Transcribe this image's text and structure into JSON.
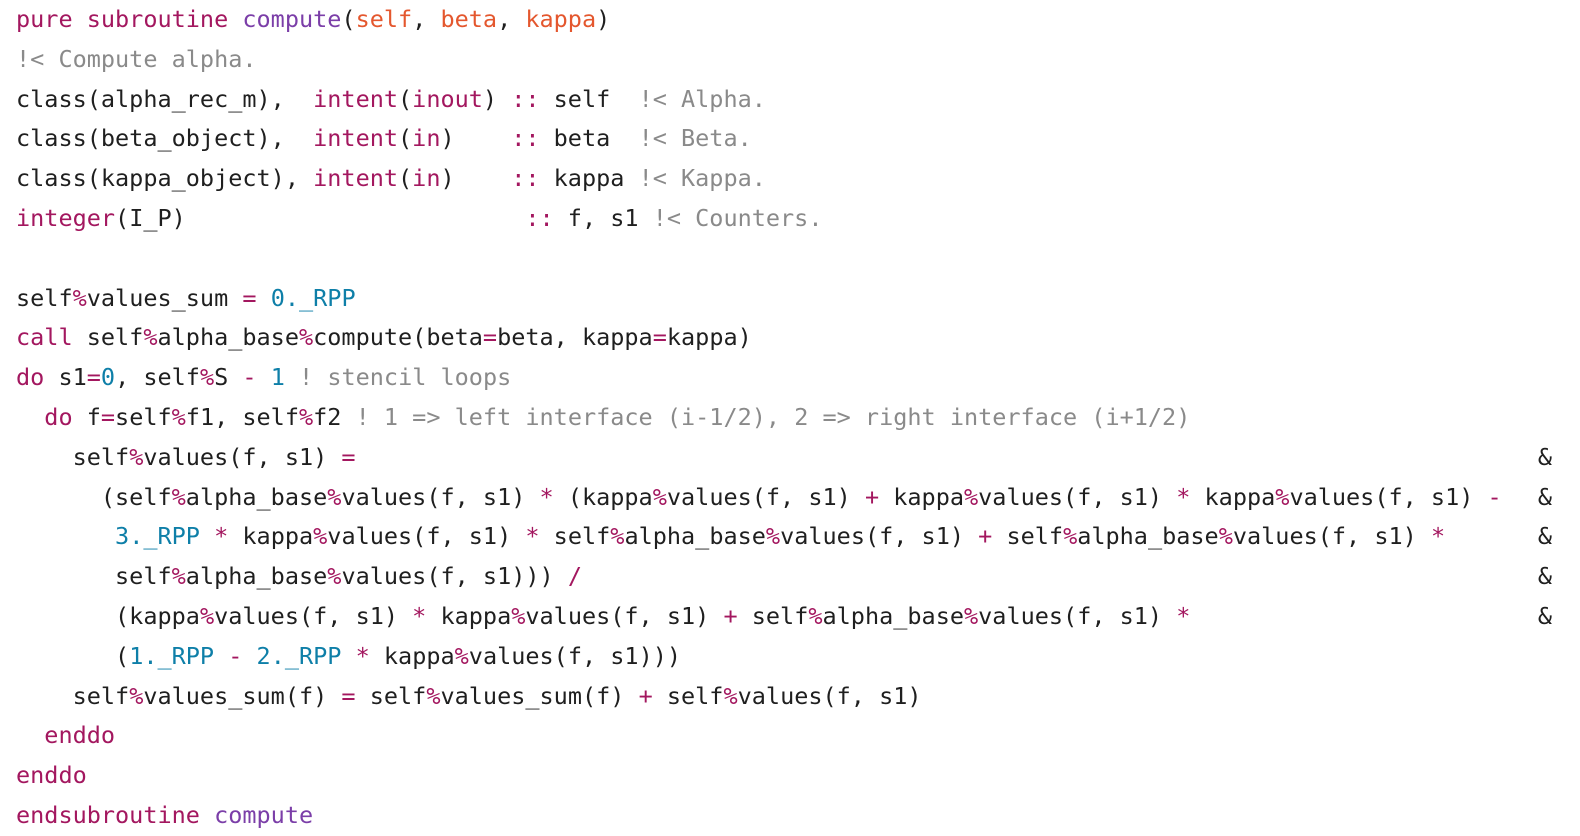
{
  "lines": [
    [
      [
        "k",
        "pure subroutine "
      ],
      [
        "p",
        "compute"
      ],
      [
        "t",
        "("
      ],
      [
        "a",
        "self"
      ],
      [
        "t",
        ", "
      ],
      [
        "a",
        "beta"
      ],
      [
        "t",
        ", "
      ],
      [
        "a",
        "kappa"
      ],
      [
        "t",
        ")"
      ]
    ],
    [
      [
        "c",
        "!< Compute alpha."
      ]
    ],
    [
      [
        "t",
        "class(alpha_rec_m),  "
      ],
      [
        "k",
        "intent"
      ],
      [
        "t",
        "("
      ],
      [
        "k",
        "inout"
      ],
      [
        "t",
        ") "
      ],
      [
        "k",
        "::"
      ],
      [
        "t",
        " self  "
      ],
      [
        "c",
        "!< Alpha."
      ]
    ],
    [
      [
        "t",
        "class(beta_object),  "
      ],
      [
        "k",
        "intent"
      ],
      [
        "t",
        "("
      ],
      [
        "k",
        "in"
      ],
      [
        "t",
        ")    "
      ],
      [
        "k",
        "::"
      ],
      [
        "t",
        " beta  "
      ],
      [
        "c",
        "!< Beta."
      ]
    ],
    [
      [
        "t",
        "class(kappa_object), "
      ],
      [
        "k",
        "intent"
      ],
      [
        "t",
        "("
      ],
      [
        "k",
        "in"
      ],
      [
        "t",
        ")    "
      ],
      [
        "k",
        "::"
      ],
      [
        "t",
        " kappa "
      ],
      [
        "c",
        "!< Kappa."
      ]
    ],
    [
      [
        "k",
        "integer"
      ],
      [
        "t",
        "(I_P)                        "
      ],
      [
        "k",
        "::"
      ],
      [
        "t",
        " f, s1 "
      ],
      [
        "c",
        "!< Counters."
      ]
    ],
    [],
    [
      [
        "t",
        "self"
      ],
      [
        "k",
        "%"
      ],
      [
        "t",
        "values_sum "
      ],
      [
        "k",
        "="
      ],
      [
        "t",
        " "
      ],
      [
        "n",
        "0._RPP"
      ]
    ],
    [
      [
        "k",
        "call"
      ],
      [
        "t",
        " self"
      ],
      [
        "k",
        "%"
      ],
      [
        "t",
        "alpha_base"
      ],
      [
        "k",
        "%"
      ],
      [
        "t",
        "compute(beta"
      ],
      [
        "k",
        "="
      ],
      [
        "t",
        "beta, kappa"
      ],
      [
        "k",
        "="
      ],
      [
        "t",
        "kappa)"
      ]
    ],
    [
      [
        "k",
        "do"
      ],
      [
        "t",
        " s1"
      ],
      [
        "k",
        "="
      ],
      [
        "n",
        "0"
      ],
      [
        "t",
        ", self"
      ],
      [
        "k",
        "%"
      ],
      [
        "t",
        "S "
      ],
      [
        "k",
        "-"
      ],
      [
        "t",
        " "
      ],
      [
        "n",
        "1"
      ],
      [
        "t",
        " "
      ],
      [
        "c",
        "! stencil loops"
      ]
    ],
    [
      [
        "t",
        "  "
      ],
      [
        "k",
        "do"
      ],
      [
        "t",
        " f"
      ],
      [
        "k",
        "="
      ],
      [
        "t",
        "self"
      ],
      [
        "k",
        "%"
      ],
      [
        "t",
        "f1, self"
      ],
      [
        "k",
        "%"
      ],
      [
        "t",
        "f2 "
      ],
      [
        "c",
        "! 1 => left interface (i-1/2), 2 => right interface (i+1/2)"
      ]
    ],
    [
      [
        "t",
        "    self"
      ],
      [
        "k",
        "%"
      ],
      [
        "t",
        "values(f, s1) "
      ],
      [
        "k",
        "="
      ]
    ],
    [
      [
        "t",
        "      (self"
      ],
      [
        "k",
        "%"
      ],
      [
        "t",
        "alpha_base"
      ],
      [
        "k",
        "%"
      ],
      [
        "t",
        "values(f, s1) "
      ],
      [
        "k",
        "*"
      ],
      [
        "t",
        " (kappa"
      ],
      [
        "k",
        "%"
      ],
      [
        "t",
        "values(f, s1) "
      ],
      [
        "k",
        "+"
      ],
      [
        "t",
        " kappa"
      ],
      [
        "k",
        "%"
      ],
      [
        "t",
        "values(f, s1) "
      ],
      [
        "k",
        "*"
      ],
      [
        "t",
        " kappa"
      ],
      [
        "k",
        "%"
      ],
      [
        "t",
        "values(f, s1) "
      ],
      [
        "k",
        "-"
      ]
    ],
    [
      [
        "t",
        "       "
      ],
      [
        "n",
        "3._RPP"
      ],
      [
        "t",
        " "
      ],
      [
        "k",
        "*"
      ],
      [
        "t",
        " kappa"
      ],
      [
        "k",
        "%"
      ],
      [
        "t",
        "values(f, s1) "
      ],
      [
        "k",
        "*"
      ],
      [
        "t",
        " self"
      ],
      [
        "k",
        "%"
      ],
      [
        "t",
        "alpha_base"
      ],
      [
        "k",
        "%"
      ],
      [
        "t",
        "values(f, s1) "
      ],
      [
        "k",
        "+"
      ],
      [
        "t",
        " self"
      ],
      [
        "k",
        "%"
      ],
      [
        "t",
        "alpha_base"
      ],
      [
        "k",
        "%"
      ],
      [
        "t",
        "values(f, s1) "
      ],
      [
        "k",
        "*"
      ]
    ],
    [
      [
        "t",
        "       self"
      ],
      [
        "k",
        "%"
      ],
      [
        "t",
        "alpha_base"
      ],
      [
        "k",
        "%"
      ],
      [
        "t",
        "values(f, s1))) "
      ],
      [
        "k",
        "/"
      ]
    ],
    [
      [
        "t",
        "       (kappa"
      ],
      [
        "k",
        "%"
      ],
      [
        "t",
        "values(f, s1) "
      ],
      [
        "k",
        "*"
      ],
      [
        "t",
        " kappa"
      ],
      [
        "k",
        "%"
      ],
      [
        "t",
        "values(f, s1) "
      ],
      [
        "k",
        "+"
      ],
      [
        "t",
        " self"
      ],
      [
        "k",
        "%"
      ],
      [
        "t",
        "alpha_base"
      ],
      [
        "k",
        "%"
      ],
      [
        "t",
        "values(f, s1) "
      ],
      [
        "k",
        "*"
      ]
    ],
    [
      [
        "t",
        "       ("
      ],
      [
        "n",
        "1._RPP"
      ],
      [
        "t",
        " "
      ],
      [
        "k",
        "-"
      ],
      [
        "t",
        " "
      ],
      [
        "n",
        "2._RPP"
      ],
      [
        "t",
        " "
      ],
      [
        "k",
        "*"
      ],
      [
        "t",
        " kappa"
      ],
      [
        "k",
        "%"
      ],
      [
        "t",
        "values(f, s1)))"
      ]
    ],
    [
      [
        "t",
        "    self"
      ],
      [
        "k",
        "%"
      ],
      [
        "t",
        "values_sum(f) "
      ],
      [
        "k",
        "="
      ],
      [
        "t",
        " self"
      ],
      [
        "k",
        "%"
      ],
      [
        "t",
        "values_sum(f) "
      ],
      [
        "k",
        "+"
      ],
      [
        "t",
        " self"
      ],
      [
        "k",
        "%"
      ],
      [
        "t",
        "values(f, s1)"
      ]
    ],
    [
      [
        "t",
        "  "
      ],
      [
        "k",
        "enddo"
      ]
    ],
    [
      [
        "k",
        "enddo"
      ]
    ],
    [
      [
        "k",
        "endsubroutine"
      ],
      [
        "t",
        " "
      ],
      [
        "p",
        "compute"
      ]
    ]
  ],
  "continuation_char": "&",
  "continuation_lines": [
    11,
    12,
    13,
    14,
    15
  ],
  "colors": {
    "keyword": "#a3175f",
    "procedure": "#7b3ea8",
    "argument": "#e4572e",
    "number": "#0e7fa8",
    "comment": "#8a8a8a",
    "text": "#1f1f1f",
    "background": "#ffffff"
  }
}
